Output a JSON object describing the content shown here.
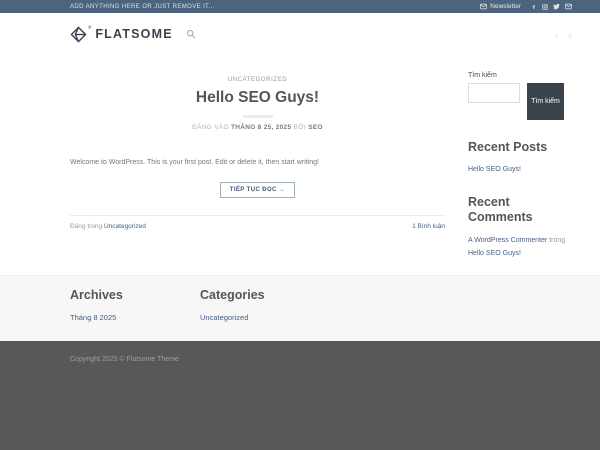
{
  "colors": {
    "topbar_bg": "#4d647e",
    "accent_link": "#446084",
    "dark_element": "#3a424c",
    "footer_dark_bg": "#585858",
    "footer_light_bg": "#f7f7f7"
  },
  "topbar": {
    "message": "ADD ANYTHING HERE OR JUST REMOVE IT...",
    "newsletter_label": "Newsletter",
    "social_icons": [
      "envelope-icon",
      "facebook-icon",
      "instagram-icon",
      "twitter-icon",
      "email-icon"
    ]
  },
  "header": {
    "logo_text": "FLATSOME",
    "registered_mark": "®",
    "search_icon": "magnifier",
    "prev_arrow": "‹",
    "next_arrow": "›"
  },
  "post": {
    "category": "UNCATEGORIZED",
    "title": "Hello SEO Guys!",
    "meta_posted_on": "ĐĂNG VÀO",
    "meta_date": "THÁNG 8 25, 2025",
    "meta_by": "BỞI",
    "meta_author": "SEO",
    "excerpt": "Welcome to WordPress. This is your first post. Edit or delete it, then start writing!",
    "read_more": "TIẾP TỤC ĐỌC →",
    "posted_in_label": "Đăng trong ",
    "posted_in_link": "Uncategorized",
    "comments_link": "1 Bình luận"
  },
  "sidebar": {
    "search_label": "Tìm kiếm",
    "search_button": "Tìm kiếm",
    "search_value": "",
    "recent_posts_title": "Recent Posts",
    "recent_posts": [
      "Hello SEO Guys!"
    ],
    "recent_comments_title": "Recent Comments",
    "recent_comment_author": "A WordPress Commenter",
    "recent_comment_in": "trong ",
    "recent_comment_post": "Hello SEO Guys!"
  },
  "footer": {
    "archives_title": "Archives",
    "archives": [
      "Tháng 8 2025"
    ],
    "categories_title": "Categories",
    "categories": [
      "Uncategorized"
    ],
    "copyright": "Copyright 2025 © Flatsome Theme"
  }
}
